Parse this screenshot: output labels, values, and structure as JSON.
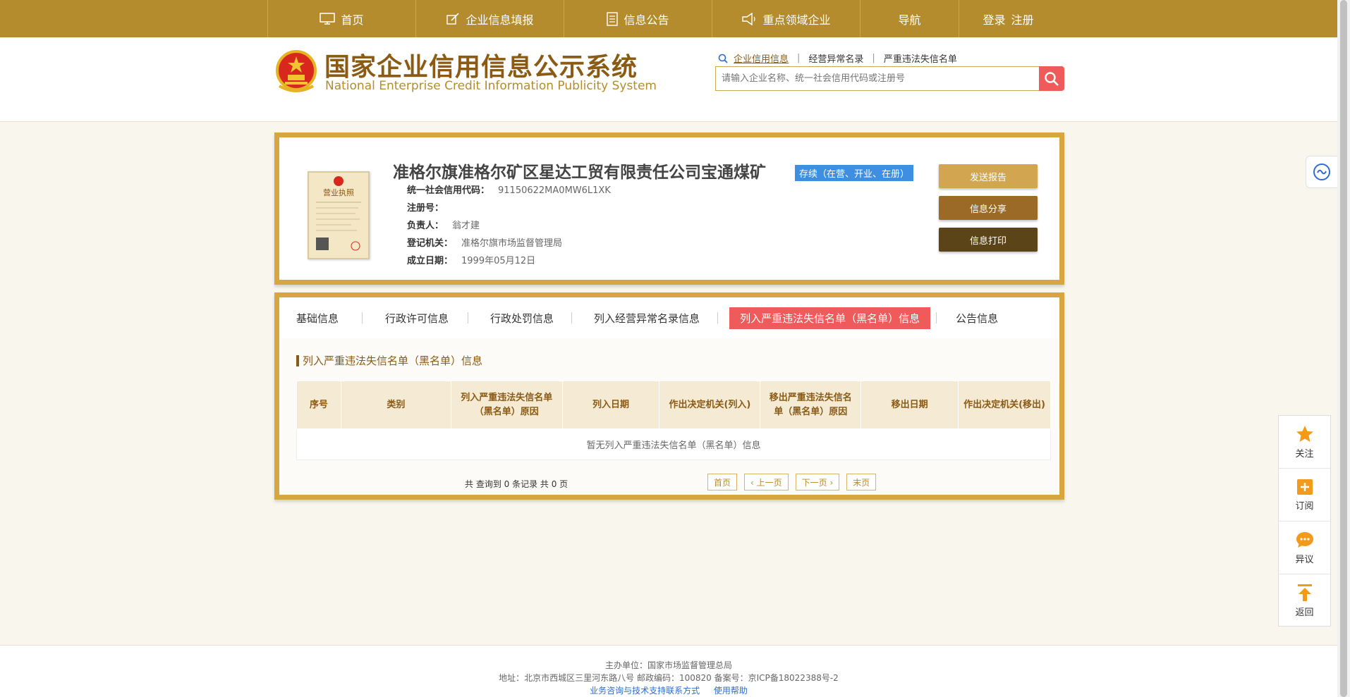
{
  "nav": {
    "items": [
      {
        "label": "首页",
        "icon": "monitor-icon"
      },
      {
        "label": "企业信息填报",
        "icon": "edit-icon"
      },
      {
        "label": "信息公告",
        "icon": "document-icon"
      },
      {
        "label": "重点领域企业",
        "icon": "megaphone-icon"
      },
      {
        "label": "导航",
        "icon": ""
      }
    ],
    "login": "登录",
    "register": "注册"
  },
  "header": {
    "title_cn": "国家企业信用信息公示系统",
    "title_en": "National Enterprise Credit Information Publicity System",
    "search_links": [
      "企业信用信息",
      "经营异常名录",
      "严重违法失信名单"
    ],
    "search_placeholder": "请输入企业名称、统一社会信用代码或注册号"
  },
  "company": {
    "name": "准格尔旗准格尔矿区星达工贸有限责任公司宝通煤矿",
    "status": "存续（在营、开业、在册）",
    "fields": [
      {
        "key": "统一社会信用代码：",
        "value": "91150622MA0MW6L1XK"
      },
      {
        "key": "注册号：",
        "value": ""
      },
      {
        "key": "负责人：",
        "value": "翁才建"
      },
      {
        "key": "登记机关：",
        "value": "准格尔旗市场监督管理局"
      },
      {
        "key": "成立日期：",
        "value": "1999年05月12日"
      }
    ],
    "license_label": "营业执照",
    "buttons": [
      "发送报告",
      "信息分享",
      "信息打印"
    ]
  },
  "tabs": [
    "基础信息",
    "行政许可信息",
    "行政处罚信息",
    "列入经营异常名录信息",
    "列入严重违法失信名单（黑名单）信息",
    "公告信息"
  ],
  "section": {
    "title": "列入严重违法失信名单（黑名单）信息",
    "columns": [
      "序号",
      "类别",
      "列入严重违法失信名单（黑名单）原因",
      "列入日期",
      "作出决定机关(列入)",
      "移出严重违法失信名单（黑名单）原因",
      "移出日期",
      "作出决定机关(移出)"
    ],
    "empty_text": "暂无列入严重违法失信名单（黑名单）信息",
    "pager_info": "共 查询到 0 条记录 共 0 页",
    "pager": [
      "首页",
      "‹ 上一页",
      "下一页 ›",
      "末页"
    ]
  },
  "side": [
    "关注",
    "订阅",
    "异议",
    "返回"
  ],
  "footer": {
    "line1": "主办单位：国家市场监督管理总局",
    "line2": "地址：北京市西城区三里河东路八号    邮政编码：100820    备案号：京ICP备18022388号-2",
    "link1": "业务咨询与技术支持联系方式",
    "link2": "使用帮助"
  },
  "colors": {
    "brand": "#b48c2e",
    "accent": "#ef5a5a",
    "status": "#3e8fe0"
  }
}
